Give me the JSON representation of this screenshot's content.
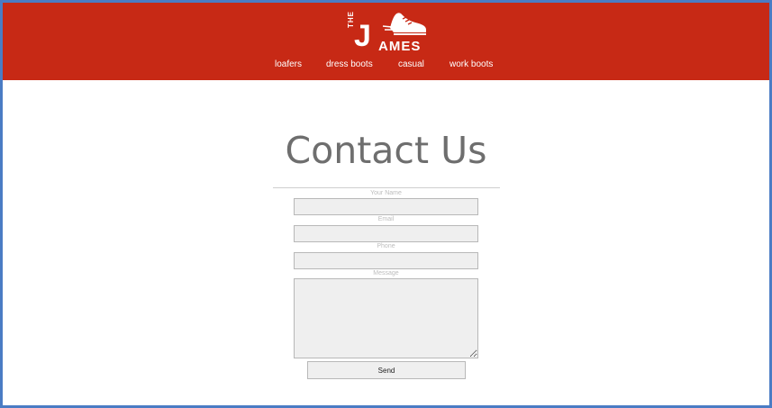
{
  "brand": {
    "logo_the": "THE",
    "logo_j": "J",
    "logo_rest": "AMES",
    "color": "#c72915",
    "icon": "sneaker-icon"
  },
  "nav": {
    "items": [
      {
        "label": "loafers"
      },
      {
        "label": "dress boots"
      },
      {
        "label": "casual"
      },
      {
        "label": "work boots"
      }
    ]
  },
  "page": {
    "title": "Contact Us"
  },
  "form": {
    "name_label": "Your Name",
    "name_value": "",
    "email_label": "Email",
    "email_value": "",
    "phone_label": "Phone",
    "phone_value": "",
    "message_label": "Message",
    "message_value": "",
    "send_label": "Send"
  }
}
